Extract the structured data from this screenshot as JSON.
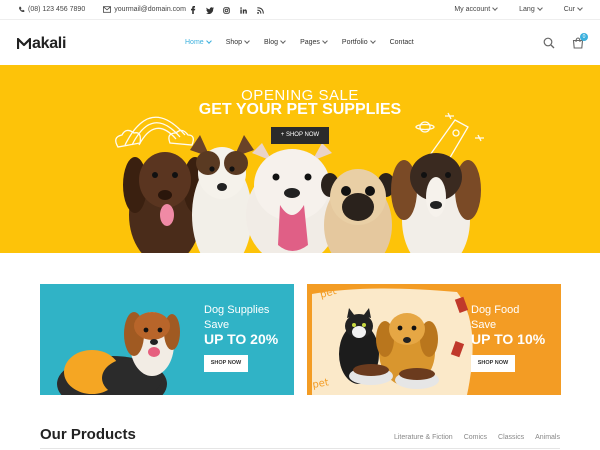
{
  "topbar": {
    "phone": "(08) 123 456 7890",
    "email": "yourmail@domain.com",
    "social_icons": [
      "facebook-icon",
      "twitter-icon",
      "instagram-icon",
      "linkedin-icon",
      "rss-icon"
    ],
    "account_label": "My account",
    "lang_label": "Lang",
    "currency_label": "Cur"
  },
  "header": {
    "logo_text": "akali",
    "nav": [
      {
        "label": "Home",
        "has_dropdown": true,
        "active": true
      },
      {
        "label": "Shop",
        "has_dropdown": true
      },
      {
        "label": "Blog",
        "has_dropdown": true
      },
      {
        "label": "Pages",
        "has_dropdown": true
      },
      {
        "label": "Portfolio",
        "has_dropdown": true
      },
      {
        "label": "Contact",
        "has_dropdown": false
      }
    ],
    "cart_count": "0",
    "accent_color": "#3bb0dd"
  },
  "hero": {
    "line1": "OPENING SALE",
    "line2": "GET YOUR PET SUPPLIES",
    "button": "+ SHOP NOW",
    "background": "#fdc309"
  },
  "banners": [
    {
      "title": "Dog Supplies",
      "sub": "Save",
      "big": "UP TO 20%",
      "button": "SHOP NOW",
      "background": "#30b3c6"
    },
    {
      "title": "Dog Food",
      "sub": "Save",
      "big": "UP TO 10%",
      "button": "SHOP NOW",
      "background": "#f39c24"
    }
  ],
  "products": {
    "title": "Our Products",
    "tabs": [
      "Literature & Fiction",
      "Comics",
      "Classics",
      "Animals"
    ]
  }
}
